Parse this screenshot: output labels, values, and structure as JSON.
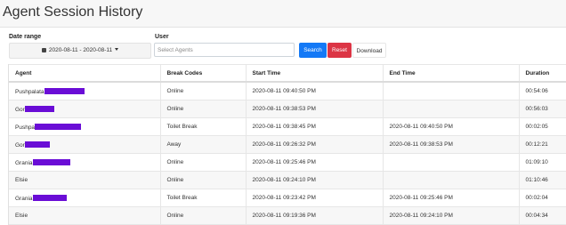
{
  "page": {
    "title": "Agent Session History"
  },
  "filters": {
    "date_range_label": "Date range",
    "date_range_value": "2020-08-11 - 2020-08-11",
    "user_label": "User",
    "user_placeholder": "Select Agents",
    "user_value": ""
  },
  "buttons": {
    "search": "Search",
    "reset": "Reset",
    "download": "Download"
  },
  "colors": {
    "search_bg": "#1479f6",
    "reset_bg": "#dc3545",
    "redaction": "#6a0dd6"
  },
  "table": {
    "columns": [
      "Agent",
      "Break Codes",
      "Start Time",
      "End Time",
      "Duration"
    ],
    "rows": [
      {
        "agent": "Pushpalata",
        "break_code": "Online",
        "start_time": "2020-08-11 09:40:50 PM",
        "end_time": "",
        "duration": "00:54:06"
      },
      {
        "agent": "Gor",
        "break_code": "Online",
        "start_time": "2020-08-11 09:38:53 PM",
        "end_time": "",
        "duration": "00:56:03"
      },
      {
        "agent": "Pushpa",
        "break_code": "Toilet Break",
        "start_time": "2020-08-11 09:38:45 PM",
        "end_time": "2020-08-11 09:40:50 PM",
        "duration": "00:02:05"
      },
      {
        "agent": "Gor",
        "break_code": "Away",
        "start_time": "2020-08-11 09:26:32 PM",
        "end_time": "2020-08-11 09:38:53 PM",
        "duration": "00:12:21"
      },
      {
        "agent": "Grania",
        "break_code": "Online",
        "start_time": "2020-08-11 09:25:46 PM",
        "end_time": "",
        "duration": "01:09:10"
      },
      {
        "agent": "Elsie",
        "break_code": "Online",
        "start_time": "2020-08-11 09:24:10 PM",
        "end_time": "",
        "duration": "01:10:46"
      },
      {
        "agent": "Grania",
        "break_code": "Toilet Break",
        "start_time": "2020-08-11 09:23:42 PM",
        "end_time": "2020-08-11 09:25:46 PM",
        "duration": "00:02:04"
      },
      {
        "agent": "Elsie",
        "break_code": "Online",
        "start_time": "2020-08-11 09:19:36 PM",
        "end_time": "2020-08-11 09:24:10 PM",
        "duration": "00:04:34"
      }
    ]
  }
}
